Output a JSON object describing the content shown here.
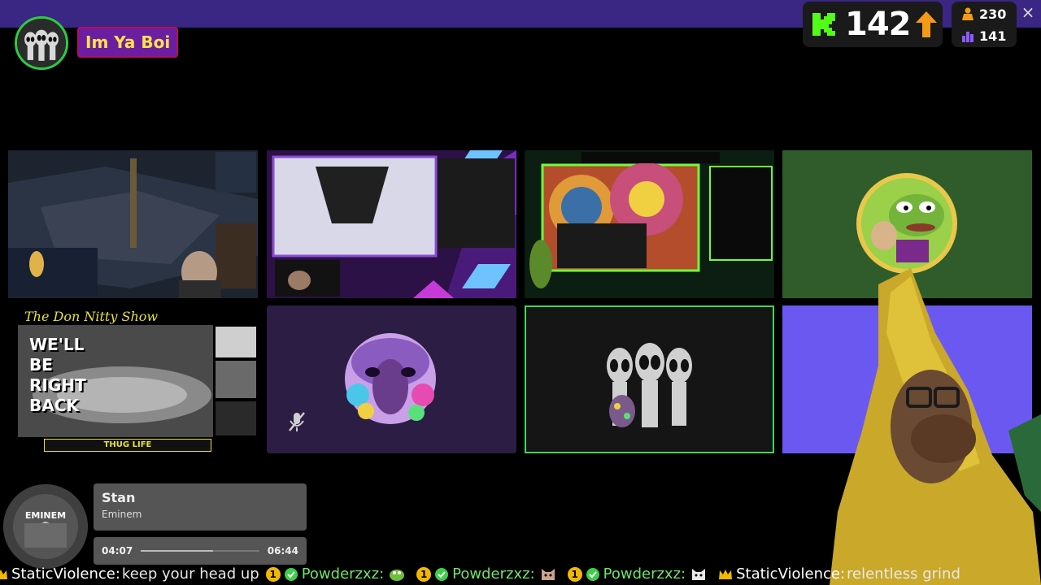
{
  "host": {
    "name": "Im Ya Boi",
    "avatar_icon": "alien-trio-icon"
  },
  "kick": {
    "logo_icon": "kick-logo-icon",
    "viewer_count": "142",
    "trend_icon": "arrow-up-icon",
    "brand_color": "#53fc18"
  },
  "stats": {
    "followers": "230",
    "subs": "141",
    "followers_icon": "person-icon",
    "subs_icon": "bar-chart-icon"
  },
  "close_icon": "×",
  "tiles": [
    {
      "name": "guest-tile-game-stream",
      "kind": "video"
    },
    {
      "name": "guest-tile-purple-stream",
      "kind": "video"
    },
    {
      "name": "guest-tile-psychedelic-stream",
      "kind": "video"
    },
    {
      "name": "guest-tile-pepe-avatar",
      "kind": "avatar"
    },
    {
      "name": "guest-tile-don-nitty-show",
      "kind": "video"
    },
    {
      "name": "guest-tile-mushroom-avatar",
      "kind": "avatar",
      "muted": true
    },
    {
      "name": "guest-tile-alien-avatar",
      "kind": "avatar",
      "speaking": true
    },
    {
      "name": "guest-tile-blank",
      "kind": "empty"
    }
  ],
  "don_show": {
    "title": "The Don Nitty Show",
    "brb_lines": [
      "WE'LL",
      "BE",
      "RIGHT",
      "BACK"
    ],
    "banner": "THUG LIFE"
  },
  "music": {
    "album_label": "EMINEM",
    "title": "Stan",
    "artist": "Eminem",
    "elapsed": "04:07",
    "duration": "06:44",
    "progress": 0.61
  },
  "ticker": [
    {
      "user": "StaticViolence:",
      "badge": "crown",
      "message": "keep your head up"
    },
    {
      "user": "Powderzxz:",
      "badge": "coin-check",
      "emote": "frog-emote"
    },
    {
      "user": "Powderzxz:",
      "badge": "coin-check",
      "emote": "cat-emote"
    },
    {
      "user": "Powderzxz:",
      "badge": "coin-check",
      "emote": "cat-emote"
    },
    {
      "user": "StaticViolence:",
      "badge": "crown",
      "message": "relentless grind"
    }
  ]
}
